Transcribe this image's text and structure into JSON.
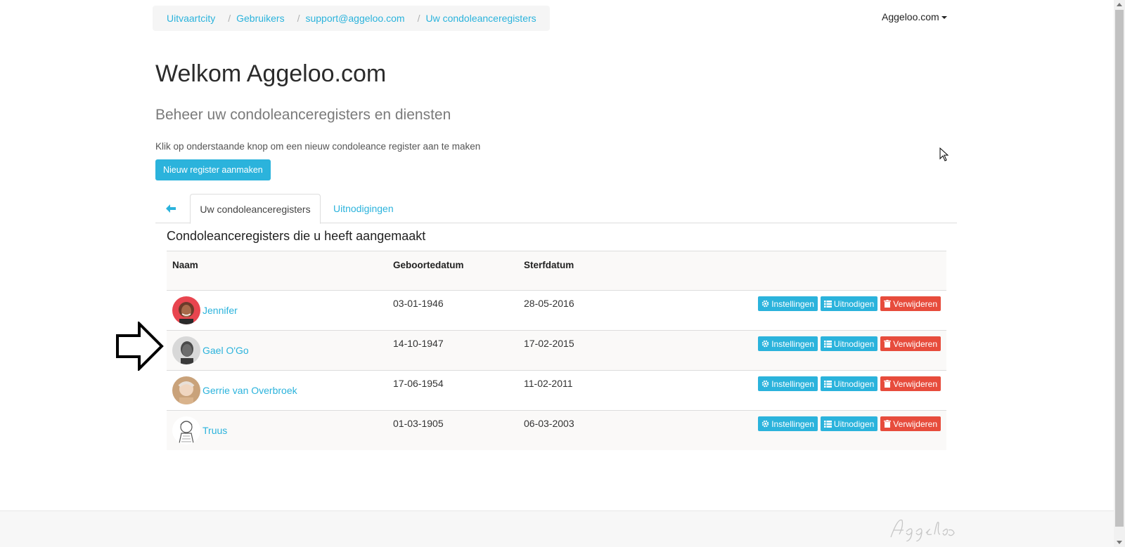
{
  "breadcrumb": {
    "items": [
      "Uitvaartcity",
      "Gebruikers",
      "support@aggeloo.com",
      "Uw condoleanceregisters"
    ],
    "separator": "/"
  },
  "account": {
    "label": "Aggeloo.com"
  },
  "heading": {
    "title": "Welkom Aggeloo.com",
    "subtitle": "Beheer uw condoleanceregisters en diensten",
    "instruction": "Klik op onderstaande knop om een nieuw condoleance register aan te maken",
    "new_button": "Nieuw register aanmaken"
  },
  "tabs": {
    "back_icon": "arrow-left-icon",
    "registers": "Uw condoleanceregisters",
    "invites": "Uitnodigingen"
  },
  "table": {
    "title": "Condoleanceregisters die u heeft aangemaakt",
    "headers": {
      "name": "Naam",
      "birth": "Geboortedatum",
      "death": "Sterfdatum"
    },
    "actions": {
      "settings": "Instellingen",
      "invite": "Uitnodigen",
      "delete": "Verwijderen"
    },
    "rows": [
      {
        "name": "Jennifer",
        "birth": "03-01-1946",
        "death": "28-05-2016"
      },
      {
        "name": "Gael O'Go",
        "birth": "14-10-1947",
        "death": "17-02-2015"
      },
      {
        "name": "Gerrie van Overbroek",
        "birth": "17-06-1954",
        "death": "11-02-2011"
      },
      {
        "name": "Truus",
        "birth": "01-03-1905",
        "death": "06-03-2003"
      }
    ]
  },
  "footer": {
    "logo_text": "Aggeloo"
  },
  "colors": {
    "accent": "#2bb3dc",
    "danger": "#e74c3c",
    "stripe": "#faf9f8"
  }
}
